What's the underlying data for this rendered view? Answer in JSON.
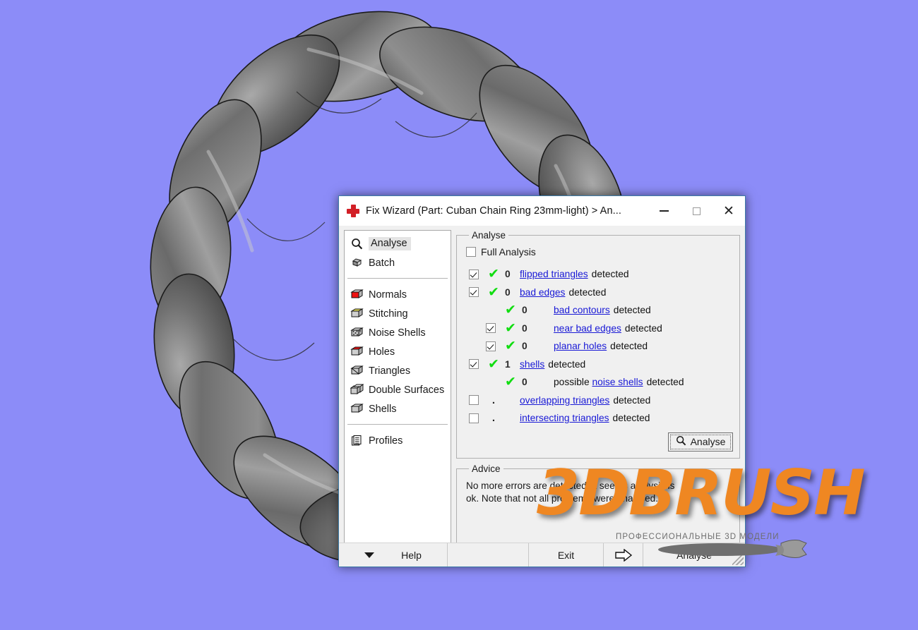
{
  "viewport": {
    "background_color": "#8c8cf8",
    "model_name": "Cuban Chain Ring 23mm-light",
    "model_color": "#6d6d6d"
  },
  "window": {
    "title": "Fix Wizard (Part: Cuban Chain Ring 23mm-light) > An...",
    "icon": "red-cross-icon",
    "controls": {
      "minimize": "—",
      "maximize": "□",
      "close": "✕"
    }
  },
  "sidebar": {
    "group1": [
      {
        "label": "Analyse",
        "icon": "magnifier-icon",
        "selected": true
      },
      {
        "label": "Batch",
        "icon": "stack-icon",
        "selected": false
      }
    ],
    "group2": [
      {
        "label": "Normals",
        "icon": "red-face-cube-icon"
      },
      {
        "label": "Stitching",
        "icon": "yellow-edge-cube-icon"
      },
      {
        "label": "Noise Shells",
        "icon": "noise-cube-icon"
      },
      {
        "label": "Holes",
        "icon": "hole-cube-icon"
      },
      {
        "label": "Triangles",
        "icon": "triangle-cube-icon"
      },
      {
        "label": "Double Surfaces",
        "icon": "double-cube-icon"
      },
      {
        "label": "Shells",
        "icon": "cube-icon"
      }
    ],
    "group3": [
      {
        "label": "Profiles",
        "icon": "document-icon"
      }
    ]
  },
  "analyse": {
    "legend": "Analyse",
    "full_analysis_label": "Full Analysis",
    "full_analysis_checked": false,
    "rows": [
      {
        "checkbox": "checked",
        "mark": "✔",
        "count": "0",
        "link": "flipped triangles",
        "prefix": "",
        "suffix": "detected",
        "indent": 0
      },
      {
        "checkbox": "checked",
        "mark": "✔",
        "count": "0",
        "link": "bad edges",
        "prefix": "",
        "suffix": "detected",
        "indent": 0
      },
      {
        "checkbox": "none",
        "mark": "✔",
        "count": "0",
        "link": "bad contours",
        "prefix": "",
        "suffix": "detected",
        "indent": 1
      },
      {
        "checkbox": "checked",
        "mark": "✔",
        "count": "0",
        "link": "near bad edges",
        "prefix": "",
        "suffix": "detected",
        "indent": 1
      },
      {
        "checkbox": "checked",
        "mark": "✔",
        "count": "0",
        "link": "planar holes",
        "prefix": "",
        "suffix": "detected",
        "indent": 1
      },
      {
        "checkbox": "checked",
        "mark": "✔",
        "count": "1",
        "link": "shells",
        "prefix": "",
        "suffix": "detected",
        "indent": 0
      },
      {
        "checkbox": "none",
        "mark": "✔",
        "count": "0",
        "link": "noise shells",
        "prefix": "possible ",
        "suffix": "detected",
        "indent": 1
      },
      {
        "checkbox": "unchecked",
        "mark": ".",
        "count": "",
        "link": "overlapping triangles",
        "prefix": "",
        "suffix": "detected",
        "indent": 0
      },
      {
        "checkbox": "unchecked",
        "mark": ".",
        "count": "",
        "link": "intersecting triangles",
        "prefix": "",
        "suffix": "detected",
        "indent": 0
      }
    ],
    "analyse_button": "Analyse",
    "link_color": "#1919d6",
    "tick_color": "#11dd11"
  },
  "advice": {
    "legend": "Advice",
    "line1": "No more errors are detected, it seems analysis is",
    "line2": "ok. Note that not all problems were analysed."
  },
  "bottombar": {
    "help": "Help",
    "exit": "Exit",
    "arrow": "⇨",
    "analyse": "Analyse"
  },
  "watermark": {
    "text": "3DBRUSH",
    "subtitle": "ПРОФЕССИОНАЛЬНЫЕ 3D МОДЕЛИ",
    "color": "#ef8722"
  }
}
